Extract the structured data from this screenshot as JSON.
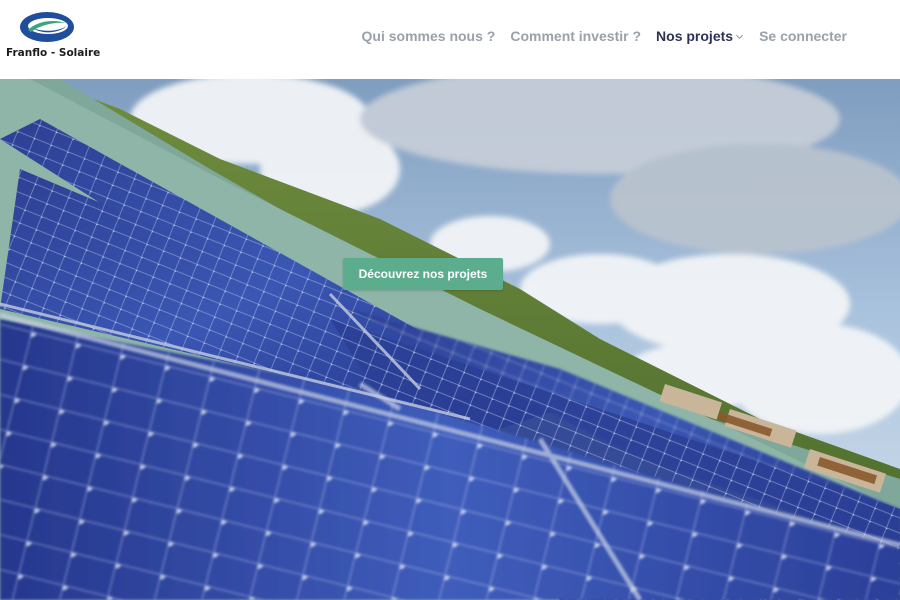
{
  "brand": {
    "name": "Franflo - Solaire",
    "logo_icon": "franflo-swoosh-logo"
  },
  "nav": {
    "items": [
      {
        "label": "Qui sommes nous ?",
        "active": false
      },
      {
        "label": "Comment investir ?",
        "active": false
      },
      {
        "label": "Nos projets",
        "active": true,
        "has_dropdown": true
      },
      {
        "label": "Se connecter",
        "active": false
      }
    ]
  },
  "hero": {
    "cta_label": "Découvrez nos projets",
    "image": "solar-panels-rooftop-photo"
  },
  "colors": {
    "nav_text": "#9aa1a8",
    "nav_active": "#2e3257",
    "cta_bg": "#5bad8e",
    "logo_blue": "#1f4f9c",
    "logo_green": "#3aa77a"
  }
}
